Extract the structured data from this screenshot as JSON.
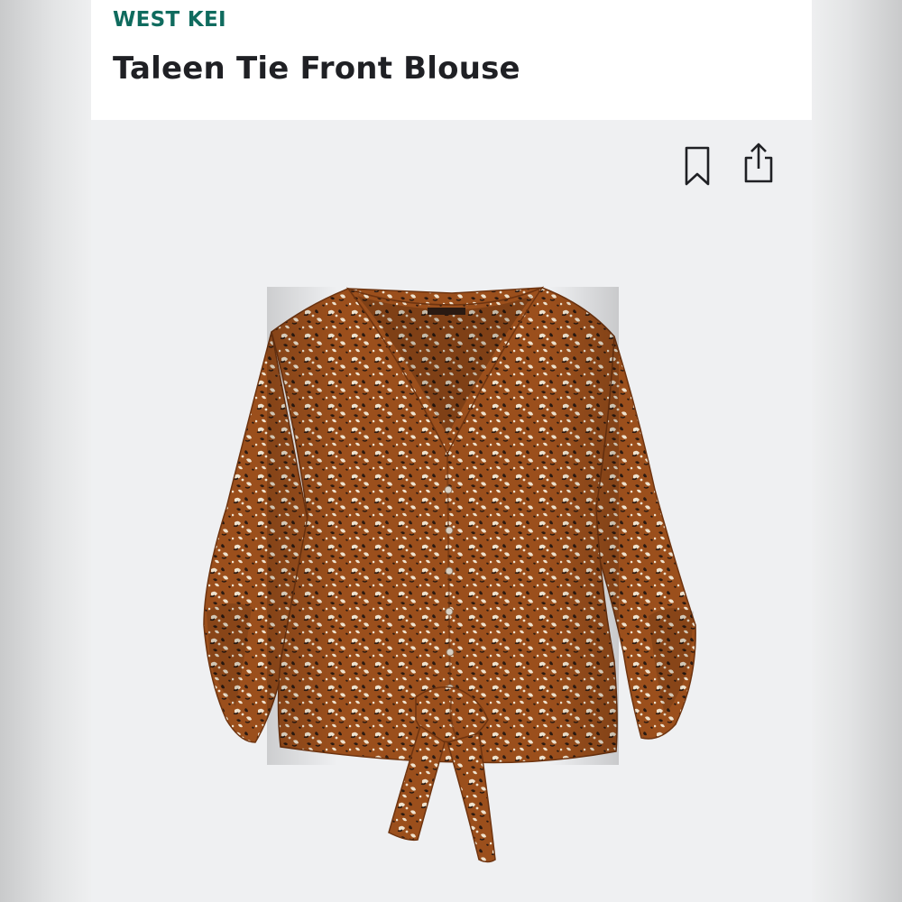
{
  "product": {
    "brand": "WEST KEI",
    "title": "Taleen Tie Front Blouse"
  },
  "actions": {
    "bookmark_icon": "bookmark-icon",
    "share_icon": "share-icon"
  },
  "image": {
    "subject": "blouse-photo"
  },
  "colors": {
    "brand": "#0f6b5e",
    "title": "#1f2024",
    "fabric": "#9b4f1c",
    "fabric_dark": "#6e3410",
    "spot_light": "#efe3cf",
    "spot_dark": "#2a1a12",
    "background": "#eff0f2"
  }
}
